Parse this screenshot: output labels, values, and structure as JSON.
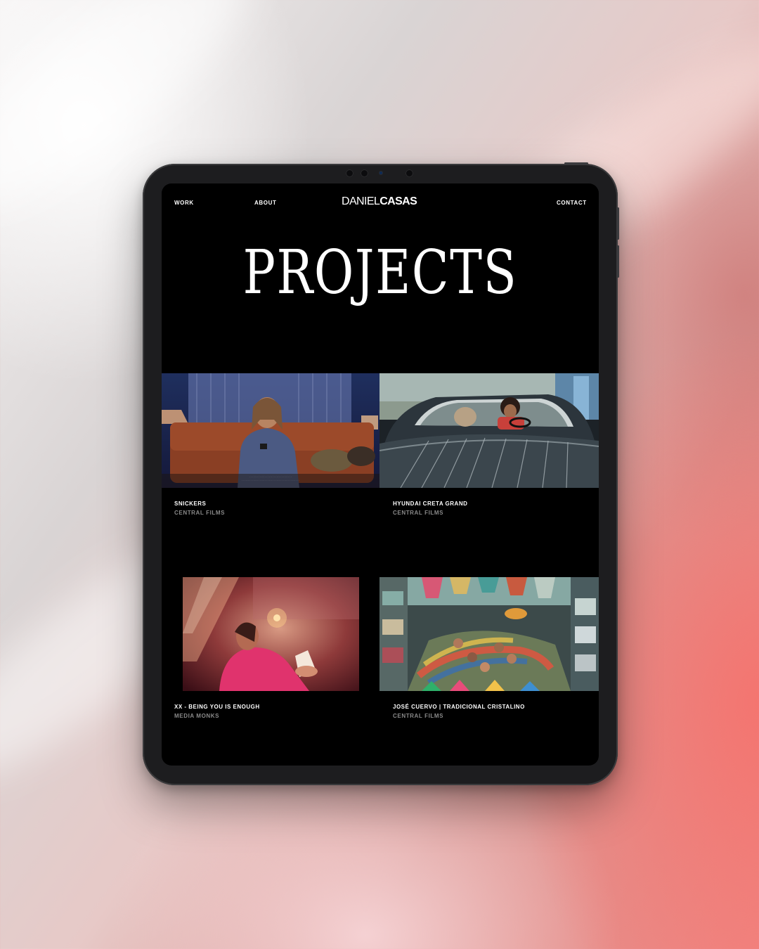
{
  "nav": {
    "work": "WORK",
    "about": "ABOUT",
    "contact": "CONTACT"
  },
  "logo": {
    "first": "DANIEL",
    "last": "CASAS"
  },
  "hero": {
    "title": "PROJECTS"
  },
  "projects": [
    {
      "title": "SNICKERS",
      "client": "CENTRAL FILMS"
    },
    {
      "title": "HYUNDAI CRETA GRAND",
      "client": "CENTRAL FILMS"
    },
    {
      "title": "XX - BEING YOU IS ENOUGH",
      "client": "MEDIA MONKS"
    },
    {
      "title": "JOSÉ CUERVO | TRADICIONAL CRISTALINO",
      "client": "CENTRAL FILMS"
    }
  ]
}
